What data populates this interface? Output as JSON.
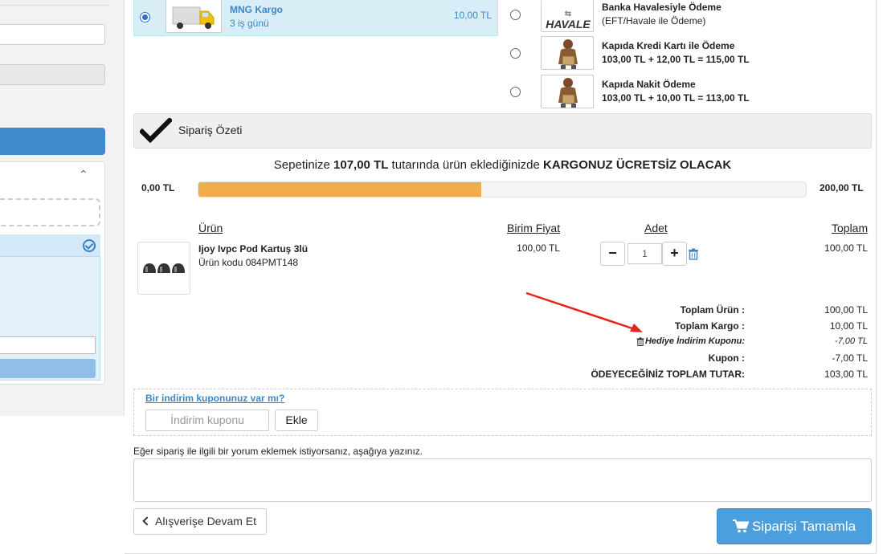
{
  "shipping": {
    "name": "MNG Kargo",
    "days": "3 iş günü",
    "price": "10,00 TL",
    "selected": true
  },
  "payment": [
    {
      "title": "Banka Havalesiyle Ödeme",
      "sub": "(EFT/Havale ile Ödeme)",
      "image_text": "HAVALE",
      "sub_bold": false
    },
    {
      "title": "Kapıda Kredi Kartı ile Ödeme",
      "sub": "103,00 TL + 12,00 TL = 115,00 TL",
      "sub_bold": true
    },
    {
      "title": "Kapıda Nakit Ödeme",
      "sub": "103,00 TL + 10,00 TL = 113,00 TL",
      "sub_bold": true
    }
  ],
  "summary": {
    "title": "Sipariş Özeti"
  },
  "promo": {
    "prefix": "Sepetinize ",
    "amount": "107,00 TL",
    "middle": " tutarında ürün eklediğinizde ",
    "suffix": "KARGONUZ ÜCRETSİZ OLACAK",
    "min": "0,00 TL",
    "max": "200,00 TL",
    "progress_percent": 46.5
  },
  "table": {
    "headers": {
      "product": "Ürün",
      "unit_price": "Birim Fiyat",
      "qty": "Adet",
      "total": "Toplam"
    }
  },
  "item": {
    "name": "Ijoy Ivpc Pod Kartuş 3lü",
    "code": "Ürün kodu 084PMT148",
    "unit_price": "100,00 TL",
    "qty": "1",
    "total": "100,00 TL",
    "minus": "−",
    "plus": "+"
  },
  "totals": {
    "product_label": "Toplam Ürün :",
    "product_value": "100,00 TL",
    "shipping_label": "Toplam Kargo :",
    "shipping_value": "10,00 TL",
    "gift_label": "Hediye İndirim Kuponu:",
    "gift_value": "-7,00 TL",
    "coupon_label": "Kupon :",
    "coupon_value": "-7,00 TL",
    "grand_label": "ÖDEYECEĞİNİZ TOPLAM TUTAR:",
    "grand_value": "103,00 TL"
  },
  "coupon": {
    "link": "Bir indirim kuponunuz var mı?",
    "placeholder": "İndirim kuponu",
    "button": "Ekle"
  },
  "note": {
    "label": "Eğer sipariş ile ilgili bir yorum eklemek istiyorsanız, aşağıya yazınız."
  },
  "actions": {
    "back": "Alışverişe Devam Et",
    "complete": "Siparişi Tamamla"
  },
  "colors": {
    "accent": "#4a9fdc",
    "progress": "#f0ad4e",
    "arrow": "#e8221c"
  }
}
